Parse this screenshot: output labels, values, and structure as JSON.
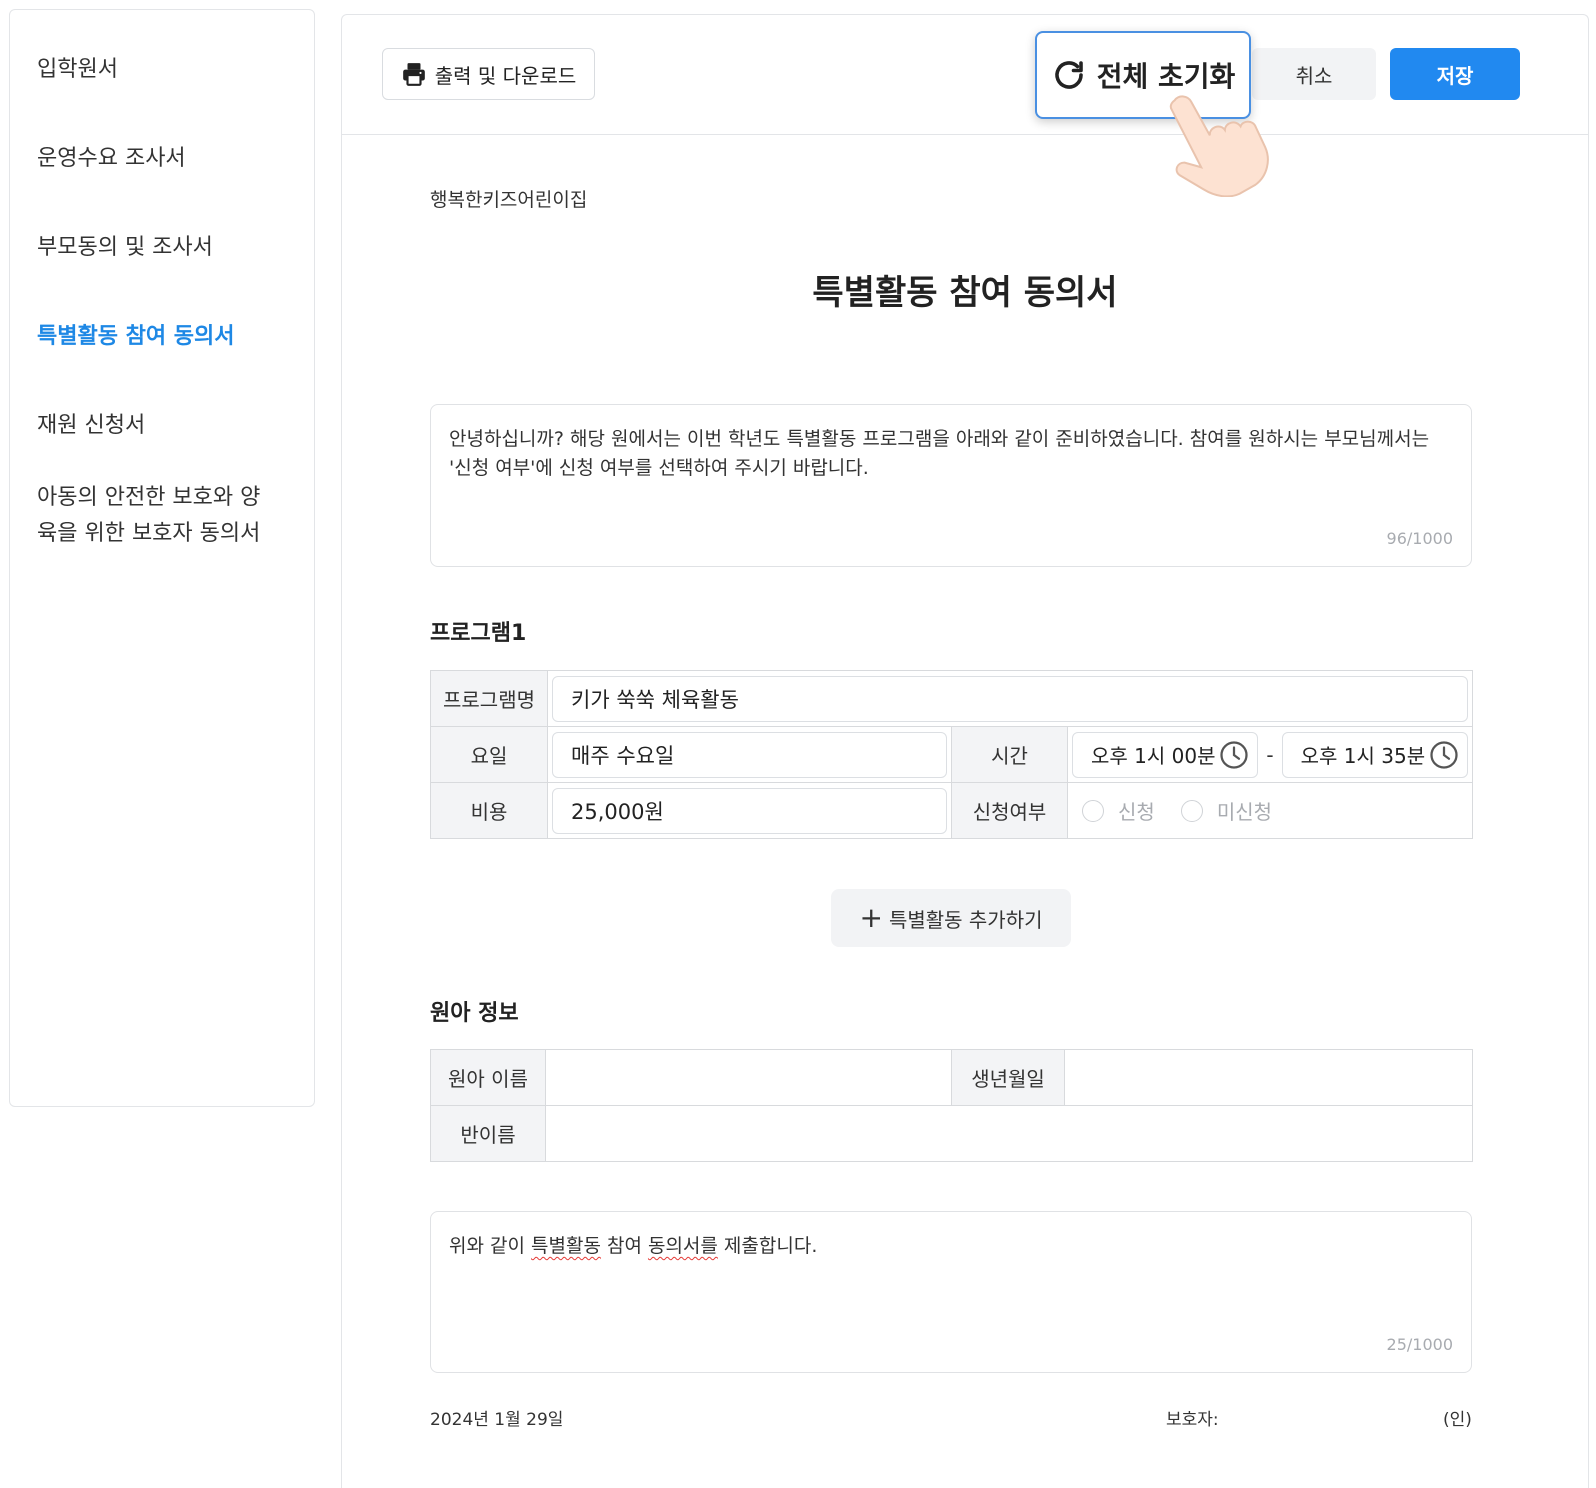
{
  "sidebar": {
    "items": [
      {
        "label": "입학원서"
      },
      {
        "label": "운영수요 조사서"
      },
      {
        "label": "부모동의 및 조사서"
      },
      {
        "label": "특별활동 참여 동의서"
      },
      {
        "label": "재원 신청서"
      },
      {
        "label": "아동의 안전한 보호와 양육을 위한 보호자 동의서"
      }
    ],
    "active_index": 3,
    "active_color": "#1e88e5"
  },
  "toolbar": {
    "print_label": "출력 및 다운로드",
    "reset_label": "전체 초기화",
    "cancel_label": "취소",
    "save_label": "저장",
    "save_color": "#2189f0"
  },
  "document": {
    "org_name": "행복한키즈어린이집",
    "title": "특별활동 참여 동의서",
    "intro_text": "안녕하십니까? 해당 원에서는 이번 학년도 특별활동 프로그램을 아래와 같이 준비하였습니다. 참여를 원하시는 부모님께서는 '신청 여부'에 신청 여부를 선택하여 주시기 바랍니다.",
    "intro_count": "96/1000"
  },
  "program": {
    "heading": "프로그램1",
    "name_label": "프로그램명",
    "name_value": "키가 쑥쑥 체육활동",
    "day_label": "요일",
    "day_value": "매주 수요일",
    "time_label": "시간",
    "time_start": "오후 1시 00분",
    "time_sep": "-",
    "time_end": "오후 1시 35분",
    "cost_label": "비용",
    "cost_value": "25,000원",
    "apply_label": "신청여부",
    "apply_options": [
      "신청",
      "미신청"
    ]
  },
  "add_activity_label": "특별활동 추가하기",
  "child": {
    "heading": "원아 정보",
    "name_label": "원아 이름",
    "name_value": "",
    "birth_label": "생년월일",
    "birth_value": "",
    "class_label": "반이름",
    "class_value": ""
  },
  "submit": {
    "text_prefix": "위와 같이 ",
    "text_word1": "특별활동",
    "text_mid": " 참여 ",
    "text_word2": "동의서를",
    "text_suffix": " 제출합니다.",
    "count": "25/1000"
  },
  "footer": {
    "date": "2024년 1월 29일",
    "guardian_label": "보호자:",
    "seal": "(인)"
  },
  "icons": {
    "print": "printer-icon",
    "reset": "refresh-icon",
    "clock": "clock-icon",
    "plus": "plus-icon",
    "cursor": "pointing-hand-icon"
  }
}
